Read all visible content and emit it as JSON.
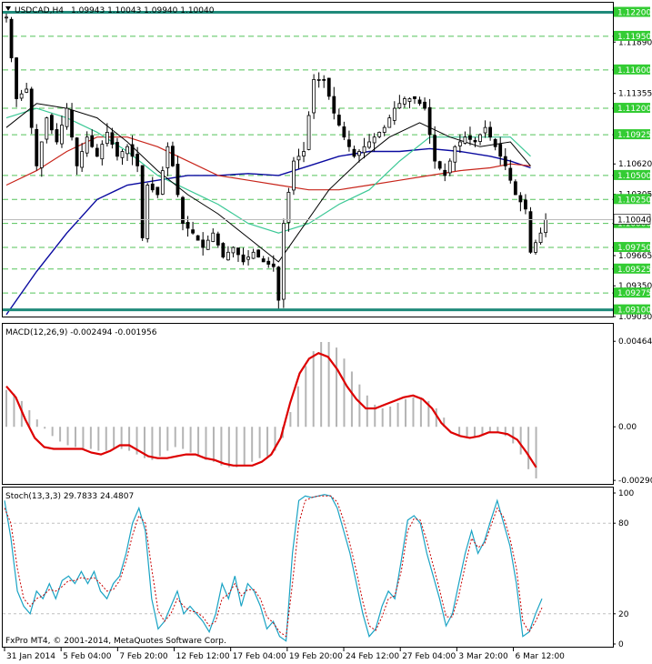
{
  "window": {
    "symbol_label": "USDCAD,H4",
    "ohlc_label": "1.09943 1.10043 1.09940 1.10040",
    "menu_icon": "triangle-down-icon",
    "copyright": "FxPro MT4, © 2001-2014, MetaQuotes Software Corp."
  },
  "colors": {
    "candle": "#000000",
    "ma_fast": "#000000",
    "ma_mid": "#3cc896",
    "ma_slow": "#c8251b",
    "ma_long": "#0a0aa0",
    "level_line": "#1f8a7a",
    "dashed_level": "#54c35a",
    "price_label_bg": "#33cc33",
    "macd_signal": "#dd0000",
    "macd_hist": "#b4b4b4",
    "stoch_main": "#1aa3c4",
    "stoch_signal": "#c80000"
  },
  "chart_data": [
    {
      "type": "candlestick",
      "title": "USDCAD,H4",
      "ylim": [
        1.0903,
        1.123
      ],
      "y_ticks": [
        "1.11890",
        "1.11355",
        "1.10620",
        "1.10305",
        "1.09665",
        "1.09350",
        "1.09030"
      ],
      "current_price": "1.10040",
      "levels_solid": [
        {
          "label": "1.12200",
          "value": 1.122
        },
        {
          "label": "1.09100",
          "value": 1.091
        }
      ],
      "levels_dashed": [
        {
          "label": "1.11950",
          "value": 1.1195
        },
        {
          "label": "1.11600",
          "value": 1.116
        },
        {
          "label": "1.11200",
          "value": 1.112
        },
        {
          "label": "1.10925",
          "value": 1.10925
        },
        {
          "label": "1.10500",
          "value": 1.105
        },
        {
          "label": "1.10250",
          "value": 1.1025
        },
        {
          "label": "1.10000",
          "value": 1.1
        },
        {
          "label": "1.09750",
          "value": 1.0975
        },
        {
          "label": "1.09525",
          "value": 1.09525
        },
        {
          "label": "1.09275",
          "value": 1.09275
        }
      ],
      "x_ticks": [
        "31 Jan 2014",
        "5 Feb 04:00",
        "7 Feb 20:00",
        "12 Feb 12:00",
        "17 Feb 04:00",
        "19 Feb 20:00",
        "24 Feb 12:00",
        "27 Feb 04:00",
        "3 Mar 20:00",
        "6 Mar 12:00"
      ],
      "close_path": [
        [
          0,
          1.1215
        ],
        [
          2,
          1.113
        ],
        [
          4,
          1.114
        ],
        [
          6,
          1.106
        ],
        [
          8,
          1.111
        ],
        [
          10,
          1.1085
        ],
        [
          12,
          1.112
        ],
        [
          14,
          1.106
        ],
        [
          16,
          1.109
        ],
        [
          18,
          1.107
        ],
        [
          20,
          1.1095
        ],
        [
          22,
          1.107
        ],
        [
          24,
          1.108
        ],
        [
          26,
          1.106
        ],
        [
          27,
          1.0985
        ],
        [
          28,
          1.104
        ],
        [
          30,
          1.103
        ],
        [
          32,
          1.108
        ],
        [
          33,
          1.106
        ],
        [
          35,
          1.1
        ],
        [
          37,
          1.099
        ],
        [
          39,
          1.0975
        ],
        [
          41,
          1.099
        ],
        [
          43,
          1.0965
        ],
        [
          45,
          1.0975
        ],
        [
          47,
          1.096
        ],
        [
          49,
          1.097
        ],
        [
          51,
          1.096
        ],
        [
          53,
          1.0955
        ],
        [
          54,
          1.092
        ],
        [
          55,
          1.1
        ],
        [
          57,
          1.1065
        ],
        [
          59,
          1.1075
        ],
        [
          61,
          1.115
        ],
        [
          63,
          1.115
        ],
        [
          65,
          1.1115
        ],
        [
          67,
          1.109
        ],
        [
          69,
          1.107
        ],
        [
          71,
          1.108
        ],
        [
          73,
          1.109
        ],
        [
          75,
          1.11
        ],
        [
          77,
          1.112
        ],
        [
          79,
          1.113
        ],
        [
          81,
          1.113
        ],
        [
          83,
          1.112
        ],
        [
          85,
          1.1065
        ],
        [
          87,
          1.105
        ],
        [
          89,
          1.108
        ],
        [
          91,
          1.109
        ],
        [
          93,
          1.1085
        ],
        [
          95,
          1.11
        ],
        [
          97,
          1.108
        ],
        [
          99,
          1.106
        ],
        [
          101,
          1.103
        ],
        [
          103,
          1.1015
        ],
        [
          104,
          1.097
        ],
        [
          106,
          1.099
        ],
        [
          107,
          1.1004
        ]
      ],
      "ma_fast": [
        [
          0,
          1.11
        ],
        [
          6,
          1.1125
        ],
        [
          12,
          1.112
        ],
        [
          18,
          1.111
        ],
        [
          24,
          1.1085
        ],
        [
          30,
          1.1055
        ],
        [
          36,
          1.103
        ],
        [
          42,
          1.101
        ],
        [
          48,
          1.0985
        ],
        [
          54,
          1.096
        ],
        [
          58,
          1.099
        ],
        [
          64,
          1.1035
        ],
        [
          70,
          1.1065
        ],
        [
          76,
          1.109
        ],
        [
          82,
          1.1105
        ],
        [
          88,
          1.109
        ],
        [
          94,
          1.108
        ],
        [
          100,
          1.1085
        ],
        [
          104,
          1.106
        ]
      ],
      "ma_mid": [
        [
          0,
          1.111
        ],
        [
          6,
          1.112
        ],
        [
          12,
          1.111
        ],
        [
          18,
          1.1095
        ],
        [
          24,
          1.1075
        ],
        [
          30,
          1.105
        ],
        [
          36,
          1.1035
        ],
        [
          42,
          1.102
        ],
        [
          48,
          1.1
        ],
        [
          54,
          1.099
        ],
        [
          60,
          1.1
        ],
        [
          66,
          1.102
        ],
        [
          72,
          1.1035
        ],
        [
          78,
          1.1065
        ],
        [
          84,
          1.109
        ],
        [
          90,
          1.109
        ],
        [
          96,
          1.109
        ],
        [
          100,
          1.109
        ],
        [
          104,
          1.107
        ]
      ],
      "ma_slow": [
        [
          0,
          1.104
        ],
        [
          6,
          1.1055
        ],
        [
          12,
          1.1075
        ],
        [
          18,
          1.109
        ],
        [
          24,
          1.109
        ],
        [
          30,
          1.108
        ],
        [
          36,
          1.1065
        ],
        [
          42,
          1.105
        ],
        [
          48,
          1.1045
        ],
        [
          54,
          1.104
        ],
        [
          60,
          1.1035
        ],
        [
          66,
          1.1035
        ],
        [
          72,
          1.104
        ],
        [
          78,
          1.1045
        ],
        [
          84,
          1.105
        ],
        [
          90,
          1.1055
        ],
        [
          96,
          1.1058
        ],
        [
          100,
          1.1062
        ],
        [
          104,
          1.106
        ]
      ],
      "ma_long": [
        [
          0,
          1.0905
        ],
        [
          6,
          1.095
        ],
        [
          12,
          1.099
        ],
        [
          18,
          1.1025
        ],
        [
          24,
          1.104
        ],
        [
          30,
          1.1045
        ],
        [
          36,
          1.105
        ],
        [
          42,
          1.105
        ],
        [
          48,
          1.1052
        ],
        [
          54,
          1.105
        ],
        [
          60,
          1.106
        ],
        [
          66,
          1.107
        ],
        [
          72,
          1.1075
        ],
        [
          78,
          1.1075
        ],
        [
          84,
          1.1078
        ],
        [
          90,
          1.1075
        ],
        [
          96,
          1.107
        ],
        [
          100,
          1.1065
        ],
        [
          104,
          1.1058
        ]
      ]
    },
    {
      "type": "histogram+line",
      "title": "MACD(12,26,9) -0.002494 -0.001956",
      "ylim": [
        -0.003,
        0.0048
      ],
      "y_ticks": [
        "0.004641",
        "0.00",
        "-0.002909"
      ],
      "histogram": [
        0.002,
        0.0018,
        0.0014,
        0.0009,
        0.0004,
        -0.0001,
        -0.0005,
        -0.0008,
        -0.001,
        -0.0011,
        -0.0012,
        -0.0012,
        -0.0013,
        -0.0013,
        -0.0012,
        -0.0012,
        -0.0013,
        -0.0015,
        -0.0017,
        -0.0018,
        -0.0016,
        -0.0013,
        -0.0011,
        -0.0012,
        -0.0014,
        -0.0016,
        -0.0018,
        -0.0019,
        -0.0021,
        -0.0022,
        -0.0022,
        -0.0021,
        -0.0019,
        -0.0017,
        -0.0016,
        -0.0013,
        -0.0006,
        0.0008,
        0.0022,
        0.0033,
        0.0041,
        0.0046,
        0.0046,
        0.0043,
        0.0037,
        0.003,
        0.0023,
        0.0017,
        0.0012,
        0.001,
        0.0011,
        0.0013,
        0.0015,
        0.0016,
        0.0016,
        0.0014,
        0.001,
        0.0005,
        0.0,
        -0.0005,
        -0.0006,
        -0.0005,
        -0.0004,
        -0.0003,
        -0.0003,
        -0.0005,
        -0.0009,
        -0.0015,
        -0.0023,
        -0.0028
      ],
      "signal": [
        0.0022,
        0.0016,
        0.0004,
        -0.0006,
        -0.0011,
        -0.0012,
        -0.0012,
        -0.0012,
        -0.0012,
        -0.0014,
        -0.0015,
        -0.0013,
        -0.001,
        -0.001,
        -0.0013,
        -0.0016,
        -0.0017,
        -0.0017,
        -0.0016,
        -0.0015,
        -0.0015,
        -0.0017,
        -0.0018,
        -0.002,
        -0.0021,
        -0.0021,
        -0.0021,
        -0.0019,
        -0.0015,
        -0.0006,
        0.0013,
        0.0029,
        0.0037,
        0.004,
        0.0038,
        0.0031,
        0.0022,
        0.0015,
        0.001,
        0.001,
        0.0012,
        0.0014,
        0.0016,
        0.0017,
        0.0015,
        0.001,
        0.0002,
        -0.0003,
        -0.0005,
        -0.0006,
        -0.0005,
        -0.0003,
        -0.0003,
        -0.0004,
        -0.0007,
        -0.0014,
        -0.0022
      ]
    },
    {
      "type": "line",
      "title": "Stoch(13,3,3) 29.7833 24.4807",
      "ylim": [
        0,
        100
      ],
      "y_ticks": [
        "100",
        "80",
        "20",
        "0"
      ],
      "main": [
        95,
        70,
        35,
        25,
        20,
        35,
        30,
        40,
        30,
        42,
        45,
        40,
        48,
        40,
        48,
        35,
        30,
        40,
        45,
        60,
        80,
        90,
        75,
        30,
        10,
        15,
        25,
        35,
        20,
        25,
        20,
        15,
        8,
        20,
        40,
        30,
        45,
        25,
        40,
        35,
        25,
        10,
        15,
        5,
        2,
        60,
        95,
        98,
        97,
        98,
        99,
        98,
        90,
        75,
        60,
        40,
        20,
        5,
        10,
        25,
        35,
        30,
        55,
        82,
        85,
        80,
        60,
        45,
        30,
        12,
        20,
        40,
        60,
        75,
        60,
        68,
        82,
        95,
        80,
        65,
        40,
        5,
        8,
        20,
        30
      ],
      "signal": [
        90,
        80,
        50,
        30,
        25,
        30,
        32,
        36,
        35,
        38,
        42,
        42,
        44,
        43,
        44,
        40,
        35,
        36,
        42,
        55,
        72,
        85,
        80,
        50,
        22,
        15,
        20,
        30,
        25,
        22,
        21,
        18,
        12,
        15,
        30,
        33,
        40,
        32,
        36,
        36,
        30,
        18,
        14,
        8,
        5,
        40,
        80,
        95,
        97,
        98,
        98,
        98,
        94,
        82,
        66,
        48,
        28,
        12,
        9,
        18,
        30,
        32,
        48,
        75,
        83,
        82,
        68,
        52,
        36,
        18,
        18,
        32,
        52,
        70,
        64,
        66,
        78,
        90,
        84,
        70,
        50,
        15,
        8,
        15,
        24
      ]
    }
  ]
}
